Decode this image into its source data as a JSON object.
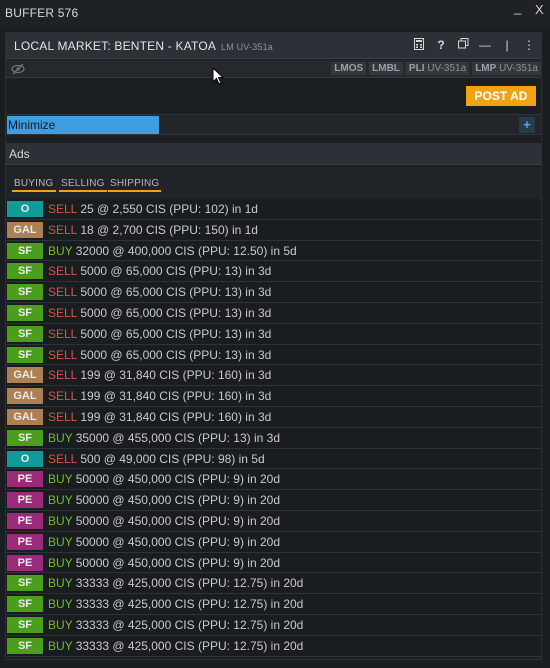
{
  "window": {
    "title": "BUFFER 576",
    "minimize_glyph": "_",
    "close_glyph": "X"
  },
  "panel": {
    "title": "LOCAL MARKET: BENTEN - KATOA",
    "subtitle": "LM UV-351a",
    "icons": [
      "calculator-icon",
      "help-icon",
      "duplicate-icon",
      "minimize-icon",
      "divider-icon",
      "more-icon"
    ]
  },
  "subbar": {
    "tags": [
      {
        "code": "LMOS",
        "suffix": ""
      },
      {
        "code": "LMBL",
        "suffix": ""
      },
      {
        "code": "PLI",
        "suffix": "UV-351a"
      },
      {
        "code": "LMP",
        "suffix": "UV-351a"
      }
    ]
  },
  "post_ad": "POST AD",
  "minimize": {
    "label": "Minimize",
    "plus": "+"
  },
  "ads": {
    "header": "Ads",
    "filters": [
      "BUYING",
      "SELLING",
      "SHIPPING"
    ]
  },
  "colors": {
    "accent": "#f0a412",
    "blue": "#3d9de0",
    "sell": "#d9534f",
    "buy": "#6fbd2e",
    "badge_O": "#129a99",
    "badge_GAL": "#ad7f52",
    "badge_SF": "#4a9e1c",
    "badge_PE": "#9c2a7a"
  },
  "rows": [
    {
      "badge": "O",
      "side": "SELL",
      "text": "25 @ 2,550 CIS (PPU: 102) in 1d"
    },
    {
      "badge": "GAL",
      "side": "SELL",
      "text": "18 @ 2,700 CIS (PPU: 150) in 1d"
    },
    {
      "badge": "SF",
      "side": "BUY",
      "text": "32000 @ 400,000 CIS (PPU: 12.50) in 5d"
    },
    {
      "badge": "SF",
      "side": "SELL",
      "text": "5000 @ 65,000 CIS (PPU: 13) in 3d"
    },
    {
      "badge": "SF",
      "side": "SELL",
      "text": "5000 @ 65,000 CIS (PPU: 13) in 3d"
    },
    {
      "badge": "SF",
      "side": "SELL",
      "text": "5000 @ 65,000 CIS (PPU: 13) in 3d"
    },
    {
      "badge": "SF",
      "side": "SELL",
      "text": "5000 @ 65,000 CIS (PPU: 13) in 3d"
    },
    {
      "badge": "SF",
      "side": "SELL",
      "text": "5000 @ 65,000 CIS (PPU: 13) in 3d"
    },
    {
      "badge": "GAL",
      "side": "SELL",
      "text": "199 @ 31,840 CIS (PPU: 160) in 3d"
    },
    {
      "badge": "GAL",
      "side": "SELL",
      "text": "199 @ 31,840 CIS (PPU: 160) in 3d"
    },
    {
      "badge": "GAL",
      "side": "SELL",
      "text": "199 @ 31,840 CIS (PPU: 160) in 3d"
    },
    {
      "badge": "SF",
      "side": "BUY",
      "text": "35000 @ 455,000 CIS (PPU: 13) in 3d"
    },
    {
      "badge": "O",
      "side": "SELL",
      "text": "500 @ 49,000 CIS (PPU: 98) in 5d"
    },
    {
      "badge": "PE",
      "side": "BUY",
      "text": "50000 @ 450,000 CIS (PPU: 9) in 20d"
    },
    {
      "badge": "PE",
      "side": "BUY",
      "text": "50000 @ 450,000 CIS (PPU: 9) in 20d"
    },
    {
      "badge": "PE",
      "side": "BUY",
      "text": "50000 @ 450,000 CIS (PPU: 9) in 20d"
    },
    {
      "badge": "PE",
      "side": "BUY",
      "text": "50000 @ 450,000 CIS (PPU: 9) in 20d"
    },
    {
      "badge": "PE",
      "side": "BUY",
      "text": "50000 @ 450,000 CIS (PPU: 9) in 20d"
    },
    {
      "badge": "SF",
      "side": "BUY",
      "text": "33333 @ 425,000 CIS (PPU: 12.75) in 20d"
    },
    {
      "badge": "SF",
      "side": "BUY",
      "text": "33333 @ 425,000 CIS (PPU: 12.75) in 20d"
    },
    {
      "badge": "SF",
      "side": "BUY",
      "text": "33333 @ 425,000 CIS (PPU: 12.75) in 20d"
    },
    {
      "badge": "SF",
      "side": "BUY",
      "text": "33333 @ 425,000 CIS (PPU: 12.75) in 20d"
    }
  ]
}
